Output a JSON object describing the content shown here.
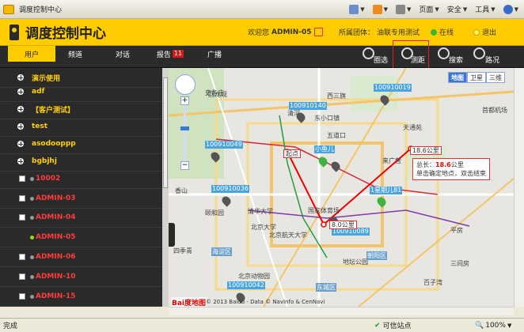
{
  "window": {
    "title": "调度控制中心"
  },
  "ie_toolbar": {
    "page_label": "页面",
    "safety_label": "安全",
    "tools_label": "工具"
  },
  "header": {
    "app_title": "调度控制中心",
    "welcome_prefix": "欢迎您",
    "username": "ADMIN-05",
    "group_prefix": "所属团体：",
    "group_name": "油联专用测试",
    "online_label": "在线",
    "logout_label": "退出"
  },
  "nav": {
    "tabs": [
      {
        "label": "用户",
        "active": true
      },
      {
        "label": "频道"
      },
      {
        "label": "对话"
      },
      {
        "label": "报告",
        "badge": "11"
      },
      {
        "label": "广播"
      }
    ],
    "tools": [
      {
        "label": "圈选",
        "icon": "circle-select-icon"
      },
      {
        "label": "测距",
        "icon": "measure-icon"
      },
      {
        "label": "搜索",
        "icon": "search-icon"
      },
      {
        "label": "路况",
        "icon": "traffic-icon"
      }
    ]
  },
  "sidebar": {
    "groups": [
      "演示使用",
      "adf",
      "【客户测试】",
      "test",
      "asodooppp",
      "bgbjhj"
    ],
    "users": [
      {
        "label": "10002",
        "status": "offline"
      },
      {
        "label": "ADMIN-03",
        "status": "offline"
      },
      {
        "label": "ADMIN-04",
        "status": "offline"
      },
      {
        "label": "ADMIN-05",
        "status": "online"
      },
      {
        "label": "ADMIN-06",
        "status": "offline"
      },
      {
        "label": "ADMIN-10",
        "status": "offline"
      },
      {
        "label": "ADMIN-15",
        "status": "offline"
      }
    ]
  },
  "map": {
    "types": [
      "地图",
      "卫星",
      "三维"
    ],
    "devices": [
      "100910019",
      "100910140",
      "100910049",
      "100910036",
      "100910089",
      "100910042"
    ],
    "measure": {
      "start_label": "起点",
      "segment1": "8.0公里",
      "segment2": "18.6公里",
      "total_prefix": "总长：",
      "total_value": "18.6",
      "total_unit": "公里",
      "hint": "单击确定地点，双击结束"
    },
    "named_markers": [
      "小鱼儿",
      "1星期儿81"
    ],
    "places": [
      "清河",
      "西三旗",
      "回龙观",
      "东小口镇",
      "来广营",
      "香山",
      "颐和园",
      "清华大学",
      "北京大学",
      "北京航天大学",
      "国家体育场",
      "地坛公园",
      "首都机场",
      "海淀区",
      "朝阳区",
      "东城区",
      "四季青",
      "北京动物园",
      "天通苑",
      "五道口",
      "平房",
      "三间房",
      "百子湾",
      "史各庄"
    ],
    "copyright": "© 2013 Baidu - Data © NavInfo & CenNavi",
    "baidu_logo": "Bai度地图"
  },
  "status": {
    "left": "完成",
    "zone": "可信站点",
    "zoom": "100%"
  },
  "colors": {
    "brand_yellow": "#ffcc00",
    "nav_dark": "#2b2b2b",
    "user_red": "#ff3b3b",
    "group_yellow": "#ffd100",
    "device_label_blue": "#4aa4e0"
  }
}
